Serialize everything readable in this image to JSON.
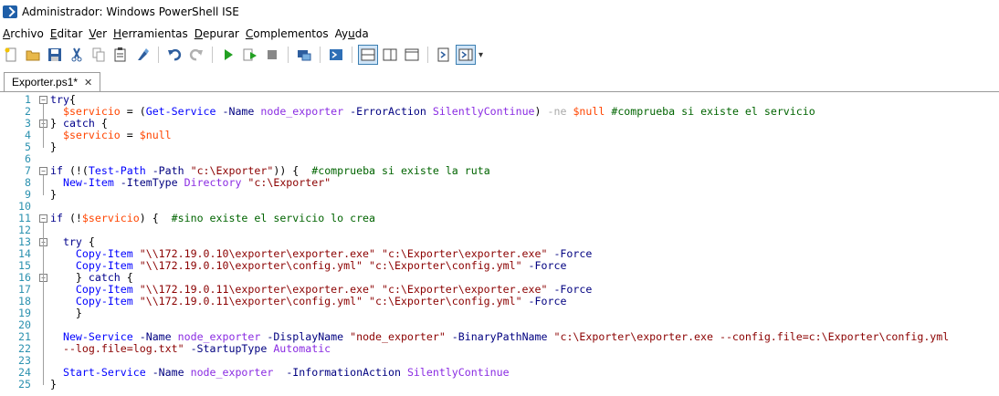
{
  "window": {
    "title": "Administrador: Windows PowerShell ISE"
  },
  "menu": [
    {
      "label": "Archivo",
      "accel": "A",
      "rest": "rchivo"
    },
    {
      "label": "Editar",
      "accel": "E",
      "rest": "ditar"
    },
    {
      "label": "Ver",
      "accel": "V",
      "rest": "er"
    },
    {
      "label": "Herramientas",
      "accel": "H",
      "rest": "erramientas"
    },
    {
      "label": "Depurar",
      "accel": "D",
      "rest": "epurar"
    },
    {
      "label": "Complementos",
      "accel": "C",
      "rest": "omplementos"
    },
    {
      "label": "Ayuda",
      "pre": "Ay",
      "accel": "u",
      "rest": "da"
    }
  ],
  "toolbar_icons": [
    "new-icon",
    "open-icon",
    "save-icon",
    "cut-icon",
    "copy-icon",
    "paste-icon",
    "clear-console-icon",
    "undo-icon",
    "redo-icon",
    "run-icon",
    "run-selection-icon",
    "stop-icon",
    "remote-tab-icon",
    "powershell-icon",
    "layout-top-icon",
    "layout-right-icon",
    "layout-max-icon",
    "show-commands-icon",
    "show-addon-icon"
  ],
  "tab": {
    "label": "Exporter.ps1*",
    "close": "✕"
  },
  "editor": {
    "lines": [
      {
        "n": "1",
        "fold": "⊟",
        "tokens": [
          [
            "k-kw",
            "try"
          ],
          [
            "",
            "{"
          ]
        ]
      },
      {
        "n": "2",
        "tokens": [
          [
            "",
            "  "
          ],
          [
            "k-var",
            "$servicio"
          ],
          [
            "",
            " = ("
          ],
          [
            "k-cmd",
            "Get-Service"
          ],
          [
            "",
            " "
          ],
          [
            "k-param",
            "-Name"
          ],
          [
            "",
            " "
          ],
          [
            "k-arg",
            "node_exporter"
          ],
          [
            "",
            " "
          ],
          [
            "k-param",
            "-ErrorAction"
          ],
          [
            "",
            " "
          ],
          [
            "k-arg",
            "SilentlyContinue"
          ],
          [
            "",
            ") "
          ],
          [
            "k-op",
            "-ne"
          ],
          [
            "",
            " "
          ],
          [
            "k-var",
            "$null"
          ],
          [
            "",
            " "
          ],
          [
            "k-com",
            "#comprueba si existe el servicio"
          ]
        ]
      },
      {
        "n": "3",
        "fold": "⊟",
        "tokens": [
          [
            "",
            "} "
          ],
          [
            "k-kw",
            "catch"
          ],
          [
            "",
            " {"
          ]
        ]
      },
      {
        "n": "4",
        "tokens": [
          [
            "",
            "  "
          ],
          [
            "k-var",
            "$servicio"
          ],
          [
            "",
            " = "
          ],
          [
            "k-var",
            "$null"
          ]
        ]
      },
      {
        "n": "5",
        "tokens": [
          [
            "",
            "}"
          ]
        ]
      },
      {
        "n": "6",
        "tokens": []
      },
      {
        "n": "7",
        "fold": "⊟",
        "tokens": [
          [
            "k-kw",
            "if"
          ],
          [
            "",
            " (!("
          ],
          [
            "k-cmd",
            "Test-Path"
          ],
          [
            "",
            " "
          ],
          [
            "k-param",
            "-Path"
          ],
          [
            "",
            " "
          ],
          [
            "k-str",
            "\"c:\\Exporter\""
          ],
          [
            "",
            ")) {  "
          ],
          [
            "k-com",
            "#comprueba si existe la ruta"
          ]
        ]
      },
      {
        "n": "8",
        "tokens": [
          [
            "",
            "  "
          ],
          [
            "k-cmd",
            "New-Item"
          ],
          [
            "",
            " "
          ],
          [
            "k-param",
            "-ItemType"
          ],
          [
            "",
            " "
          ],
          [
            "k-arg",
            "Directory"
          ],
          [
            "",
            " "
          ],
          [
            "k-str",
            "\"c:\\Exporter\""
          ]
        ]
      },
      {
        "n": "9",
        "tokens": [
          [
            "",
            "}"
          ]
        ]
      },
      {
        "n": "10",
        "tokens": []
      },
      {
        "n": "11",
        "fold": "⊟",
        "tokens": [
          [
            "k-kw",
            "if"
          ],
          [
            "",
            " (!"
          ],
          [
            "k-var",
            "$servicio"
          ],
          [
            "",
            ") {  "
          ],
          [
            "k-com",
            "#sino existe el servicio lo crea"
          ]
        ]
      },
      {
        "n": "12",
        "tokens": []
      },
      {
        "n": "13",
        "fold": "⊟",
        "tokens": [
          [
            "",
            "  "
          ],
          [
            "k-kw",
            "try"
          ],
          [
            "",
            " {"
          ]
        ]
      },
      {
        "n": "14",
        "tokens": [
          [
            "",
            "    "
          ],
          [
            "k-cmd",
            "Copy-Item"
          ],
          [
            "",
            " "
          ],
          [
            "k-str",
            "\"\\\\172.19.0.10\\exporter\\exporter.exe\""
          ],
          [
            "",
            " "
          ],
          [
            "k-str",
            "\"c:\\Exporter\\exporter.exe\""
          ],
          [
            "",
            " "
          ],
          [
            "k-param",
            "-Force"
          ]
        ]
      },
      {
        "n": "15",
        "tokens": [
          [
            "",
            "    "
          ],
          [
            "k-cmd",
            "Copy-Item"
          ],
          [
            "",
            " "
          ],
          [
            "k-str",
            "\"\\\\172.19.0.10\\exporter\\config.yml\""
          ],
          [
            "",
            " "
          ],
          [
            "k-str",
            "\"c:\\Exporter\\config.yml\""
          ],
          [
            "",
            " "
          ],
          [
            "k-param",
            "-Force"
          ]
        ]
      },
      {
        "n": "16",
        "fold": "⊟",
        "tokens": [
          [
            "",
            "    } "
          ],
          [
            "k-kw",
            "catch"
          ],
          [
            "",
            " {"
          ]
        ]
      },
      {
        "n": "17",
        "tokens": [
          [
            "",
            "    "
          ],
          [
            "k-cmd",
            "Copy-Item"
          ],
          [
            "",
            " "
          ],
          [
            "k-str",
            "\"\\\\172.19.0.11\\exporter\\exporter.exe\""
          ],
          [
            "",
            " "
          ],
          [
            "k-str",
            "\"c:\\Exporter\\exporter.exe\""
          ],
          [
            "",
            " "
          ],
          [
            "k-param",
            "-Force"
          ]
        ]
      },
      {
        "n": "18",
        "tokens": [
          [
            "",
            "    "
          ],
          [
            "k-cmd",
            "Copy-Item"
          ],
          [
            "",
            " "
          ],
          [
            "k-str",
            "\"\\\\172.19.0.11\\exporter\\config.yml\""
          ],
          [
            "",
            " "
          ],
          [
            "k-str",
            "\"c:\\Exporter\\config.yml\""
          ],
          [
            "",
            " "
          ],
          [
            "k-param",
            "-Force"
          ]
        ]
      },
      {
        "n": "19",
        "tokens": [
          [
            "",
            "    }"
          ]
        ]
      },
      {
        "n": "20",
        "tokens": []
      },
      {
        "n": "21",
        "tokens": [
          [
            "",
            "  "
          ],
          [
            "k-cmd",
            "New-Service"
          ],
          [
            "",
            " "
          ],
          [
            "k-param",
            "-Name"
          ],
          [
            "",
            " "
          ],
          [
            "k-arg",
            "node_exporter"
          ],
          [
            "",
            " "
          ],
          [
            "k-param",
            "-DisplayName"
          ],
          [
            "",
            " "
          ],
          [
            "k-str",
            "\"node_exporter\""
          ],
          [
            "",
            " "
          ],
          [
            "k-param",
            "-BinaryPathName"
          ],
          [
            "",
            " "
          ],
          [
            "k-str",
            "\"c:\\Exporter\\exporter.exe --config.file=c:\\Exporter\\config.yml"
          ]
        ]
      },
      {
        "n": "22",
        "tokens": [
          [
            "",
            "  "
          ],
          [
            "k-str",
            "--log.file=log.txt\""
          ],
          [
            "",
            " "
          ],
          [
            "k-param",
            "-StartupType"
          ],
          [
            "",
            " "
          ],
          [
            "k-arg",
            "Automatic"
          ]
        ]
      },
      {
        "n": "23",
        "tokens": []
      },
      {
        "n": "24",
        "tokens": [
          [
            "",
            "  "
          ],
          [
            "k-cmd",
            "Start-Service"
          ],
          [
            "",
            " "
          ],
          [
            "k-param",
            "-Name"
          ],
          [
            "",
            " "
          ],
          [
            "k-arg",
            "node_exporter"
          ],
          [
            "",
            "  "
          ],
          [
            "k-param",
            "-InformationAction"
          ],
          [
            "",
            " "
          ],
          [
            "k-arg",
            "SilentlyContinue"
          ]
        ]
      },
      {
        "n": "25",
        "tokens": [
          [
            "",
            "}"
          ]
        ]
      }
    ]
  }
}
